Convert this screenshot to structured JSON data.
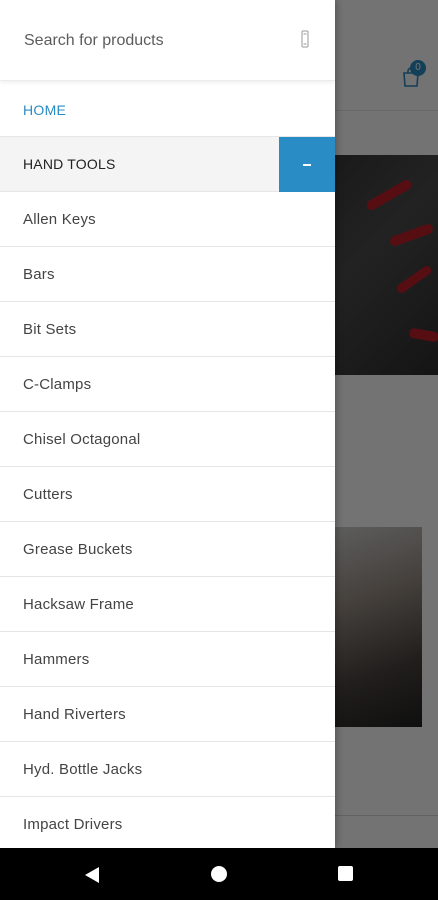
{
  "search": {
    "placeholder": "Search for products"
  },
  "header": {
    "cart_count": "0"
  },
  "menu": {
    "home_label": "HOME",
    "category_label": "HAND TOOLS",
    "items": [
      {
        "label": "Allen Keys"
      },
      {
        "label": "Bars"
      },
      {
        "label": "Bit Sets"
      },
      {
        "label": "C-Clamps"
      },
      {
        "label": "Chisel Octagonal"
      },
      {
        "label": "Cutters"
      },
      {
        "label": "Grease Buckets"
      },
      {
        "label": "Hacksaw Frame"
      },
      {
        "label": "Hammers"
      },
      {
        "label": "Hand Riverters"
      },
      {
        "label": "Hyd. Bottle Jacks"
      },
      {
        "label": "Impact Drivers"
      }
    ]
  },
  "colors": {
    "accent": "#2a8cc4"
  }
}
